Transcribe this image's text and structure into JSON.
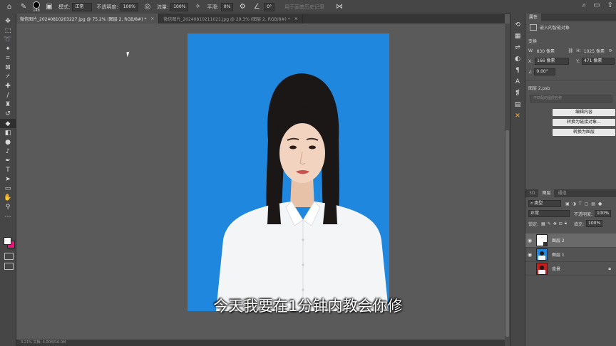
{
  "options_bar": {
    "brush_size": "148",
    "mode_label": "模式:",
    "mode_value": "正常",
    "opacity_label": "不透明度:",
    "opacity_value": "100%",
    "flow_label": "流量:",
    "flow_value": "100%",
    "smooth_label": "平滑:",
    "smooth_value": "0%",
    "angle_value": "0°",
    "history_label": "用于画笔历史记录"
  },
  "tabs": [
    {
      "label": "微信图片_20240810203227.jpg @ 75.2% (图层 2, RGB/8#) *",
      "active": true
    },
    {
      "label": "微信图片_20240810211021.jpg @ 29.3% (图层 2, RGB/8#) *",
      "active": false
    }
  ],
  "subtitle": "今天我要在1分钟内教会你修",
  "status_text": "3.21% 文档: 4.00M/16.0M",
  "properties": {
    "tab_label": "属性",
    "layer_type": "嵌入的智能对象",
    "transform_label": "变换",
    "w_label": "W:",
    "w_value": "830 像素",
    "h_label": "H:",
    "h_value": "1025 像素",
    "x_label": "X:",
    "x_value": "166 像素",
    "y_label": "Y:",
    "y_value": "471 像素",
    "angle_value": "0.00°",
    "file_name": "图层 2.psb",
    "search_placeholder": "不匹配的图层名称",
    "btn_edit": "编辑内容",
    "btn_convert_linked": "转换为链接对象...",
    "btn_convert_layer": "转换为图层"
  },
  "layers_panel": {
    "tabs": [
      "3D",
      "图层",
      "通道"
    ],
    "filter_value": "类型",
    "blend_value": "正常",
    "opacity_label": "不透明度:",
    "opacity_value": "100%",
    "lock_label": "锁定:",
    "fill_label": "填充:",
    "fill_value": "100%",
    "layers": [
      {
        "name": "图层 2",
        "selected": true
      },
      {
        "name": "图层 1",
        "selected": false
      },
      {
        "name": "背景",
        "selected": false
      }
    ]
  },
  "colors": {
    "photo_background": "#1f87de",
    "foreground_swatch": "#ffffff",
    "background_swatch": "#e8157a",
    "panel_bg": "#535353"
  }
}
